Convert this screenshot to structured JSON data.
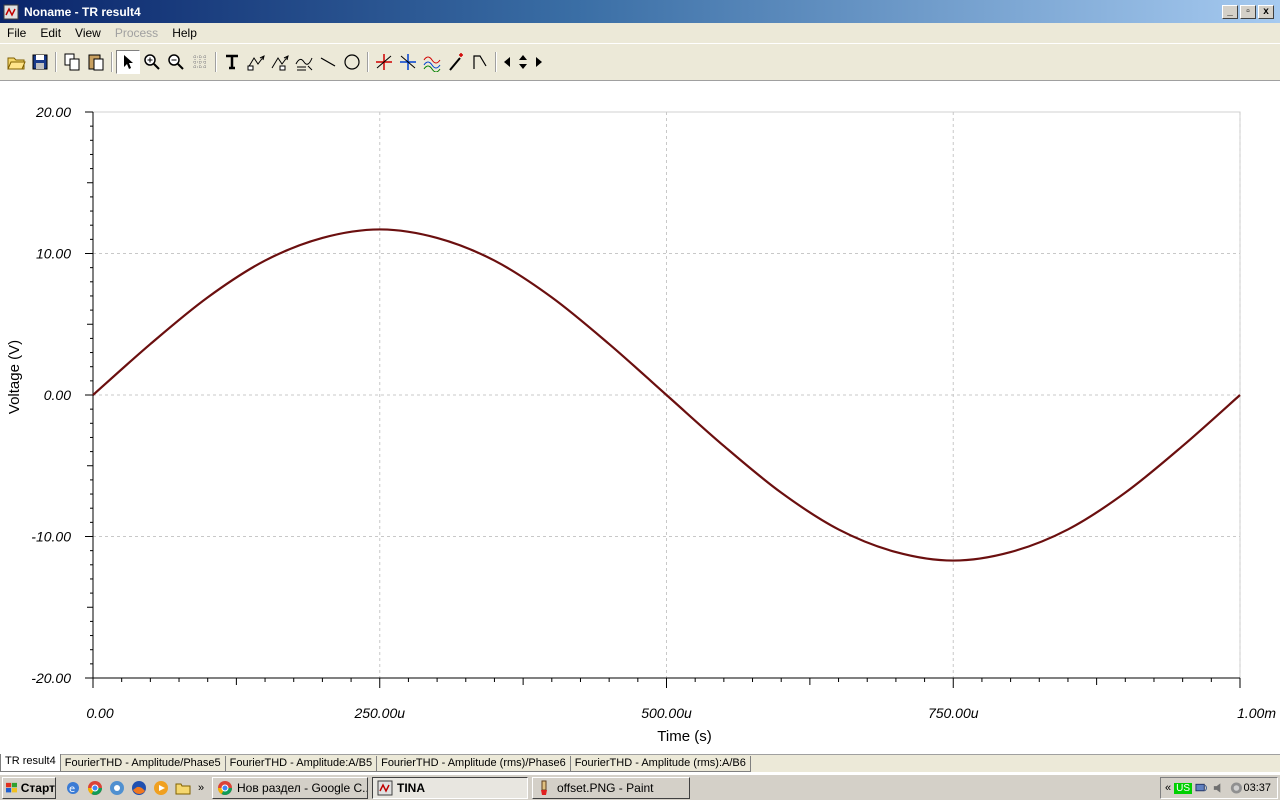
{
  "window": {
    "title": "Noname - TR result4",
    "controls": [
      "_",
      "▫",
      "x"
    ]
  },
  "menu": [
    {
      "label": "File",
      "enabled": true
    },
    {
      "label": "Edit",
      "enabled": true
    },
    {
      "label": "View",
      "enabled": true
    },
    {
      "label": "Process",
      "enabled": false
    },
    {
      "label": "Help",
      "enabled": true
    }
  ],
  "toolbar_icons": [
    "open-folder-icon",
    "save-icon",
    "copy-icon",
    "paste-icon",
    "pointer-icon",
    "zoom-in-icon",
    "zoom-out-icon",
    "grid-icon",
    "text-icon",
    "cursor-a-icon",
    "cursor-b-icon",
    "curve-label-icon",
    "line-icon",
    "circle-icon",
    "marker-a-icon",
    "marker-b-icon",
    "wave-icon",
    "probe-icon",
    "slope-icon",
    "nav-left-icon",
    "nav-updown-icon",
    "nav-right-icon"
  ],
  "chart_data": {
    "type": "line",
    "xlabel": "Time (s)",
    "ylabel": "Voltage (V)",
    "xlim": [
      0,
      0.001
    ],
    "ylim": [
      -20,
      20
    ],
    "x_ticks": [
      {
        "value": 0,
        "label": "0.00"
      },
      {
        "value": 0.00025,
        "label": "250.00u"
      },
      {
        "value": 0.0005,
        "label": "500.00u"
      },
      {
        "value": 0.00075,
        "label": "750.00u"
      },
      {
        "value": 0.001,
        "label": "1.00m"
      }
    ],
    "y_ticks": [
      {
        "value": 20,
        "label": "20.00"
      },
      {
        "value": 10,
        "label": "10.00"
      },
      {
        "value": 0,
        "label": "0.00"
      },
      {
        "value": -10,
        "label": "-10.00"
      },
      {
        "value": -20,
        "label": "-20.00"
      }
    ],
    "grid": true,
    "series": [
      {
        "color": "#6b0f0f",
        "x": [
          0,
          5e-05,
          0.0001,
          0.00015,
          0.0002,
          0.00025,
          0.0003,
          0.00035,
          0.0004,
          0.00045,
          0.0005,
          0.00055,
          0.0006,
          0.00065,
          0.0007,
          0.00075,
          0.0008,
          0.00085,
          0.0009,
          0.00095,
          0.001
        ],
        "y": [
          0,
          3.6,
          6.9,
          9.5,
          11.1,
          11.7,
          11.1,
          9.5,
          6.9,
          3.6,
          0,
          -3.6,
          -6.9,
          -9.5,
          -11.1,
          -11.7,
          -11.1,
          -9.5,
          -6.9,
          -3.6,
          0
        ]
      }
    ]
  },
  "tabs": [
    {
      "label": "TR result4",
      "active": true
    },
    {
      "label": "FourierTHD - Amplitude/Phase5",
      "active": false
    },
    {
      "label": "FourierTHD - Amplitude:A/B5",
      "active": false
    },
    {
      "label": "FourierTHD - Amplitude (rms)/Phase6",
      "active": false
    },
    {
      "label": "FourierTHD - Amplitude (rms):A/B6",
      "active": false
    }
  ],
  "taskbar": {
    "start_label": "Старт",
    "tasks": [
      {
        "label": "Нов раздел - Google C...",
        "active": false
      },
      {
        "label": "TINA",
        "active": true
      },
      {
        "label": "offset.PNG - Paint",
        "active": false
      }
    ],
    "tray": {
      "lang": "US",
      "clock": "03:37",
      "expand": "«"
    }
  }
}
